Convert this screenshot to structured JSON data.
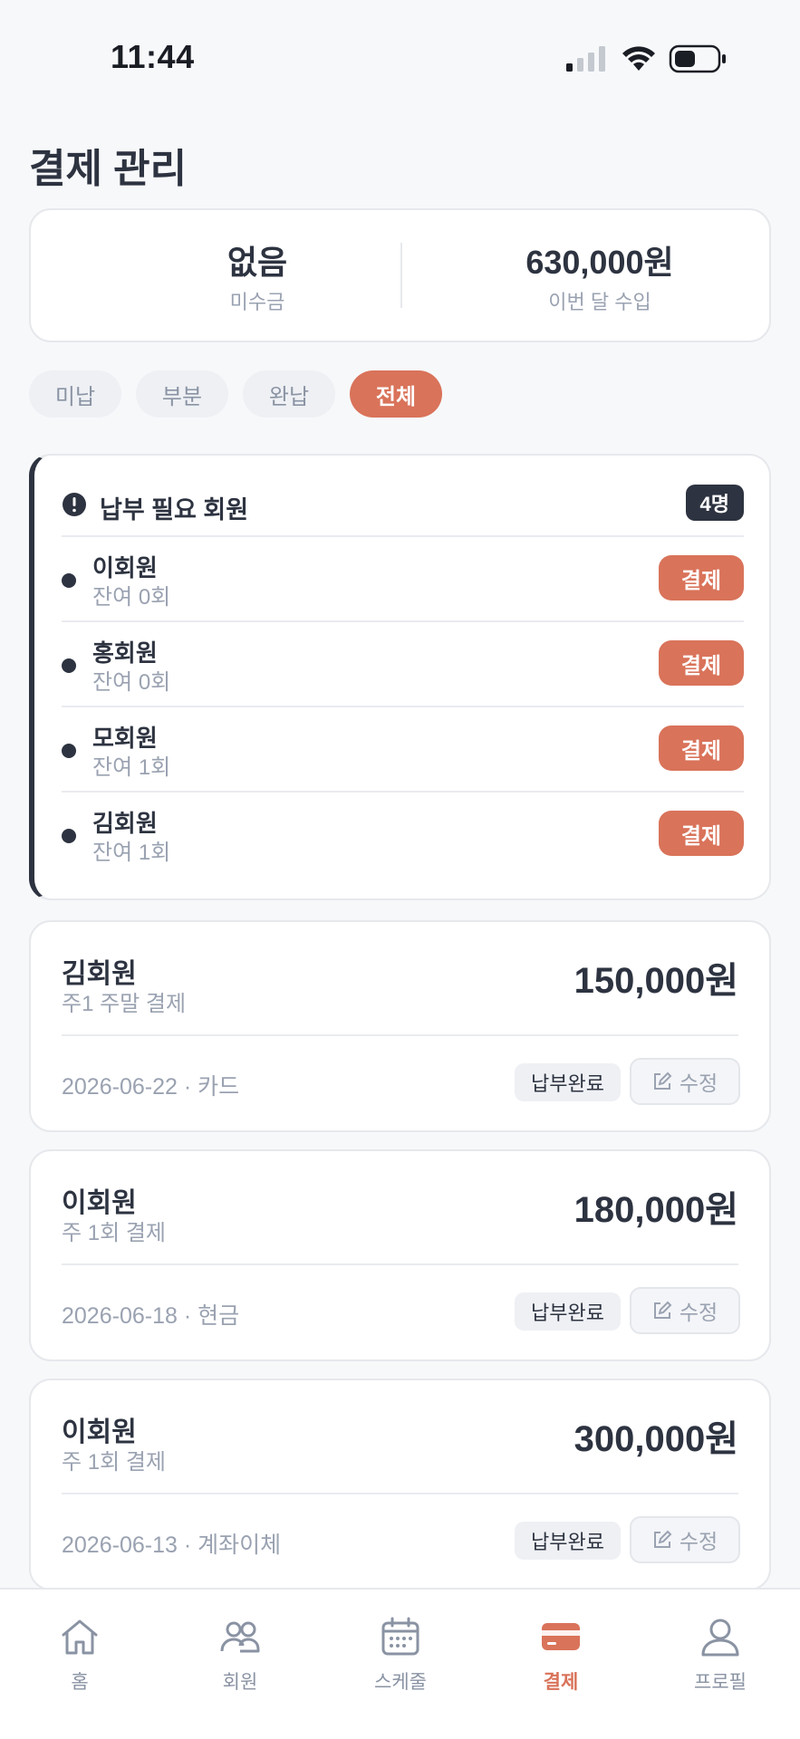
{
  "status_bar": {
    "time": "11:44"
  },
  "page": {
    "title": "결제 관리"
  },
  "summary": {
    "unpaid_value": "없음",
    "unpaid_label": "미수금",
    "income_value": "630,000원",
    "income_label": "이번 달 수입"
  },
  "filters": [
    {
      "label": "미납",
      "active": false
    },
    {
      "label": "부분",
      "active": false
    },
    {
      "label": "완납",
      "active": false
    },
    {
      "label": "전체",
      "active": true
    }
  ],
  "due_section": {
    "title": "납부 필요 회원",
    "count": "4명",
    "members": [
      {
        "name": "이회원",
        "remaining": "잔여 0회",
        "button": "결제"
      },
      {
        "name": "홍회원",
        "remaining": "잔여 0회",
        "button": "결제"
      },
      {
        "name": "모회원",
        "remaining": "잔여 1회",
        "button": "결제"
      },
      {
        "name": "김회원",
        "remaining": "잔여 1회",
        "button": "결제"
      }
    ]
  },
  "payments": [
    {
      "name": "김회원",
      "plan": "주1 주말 결제",
      "amount": "150,000원",
      "meta": "2026-06-22 · 카드",
      "status": "납부완료",
      "edit_label": "수정"
    },
    {
      "name": "이회원",
      "plan": "주 1회 결제",
      "amount": "180,000원",
      "meta": "2026-06-18 · 현금",
      "status": "납부완료",
      "edit_label": "수정"
    },
    {
      "name": "이회원",
      "plan": "주 1회 결제",
      "amount": "300,000원",
      "meta": "2026-06-13 · 계좌이체",
      "status": "납부완료",
      "edit_label": "수정"
    }
  ],
  "tab_bar": [
    {
      "label": "홈",
      "icon": "home-icon",
      "active": false
    },
    {
      "label": "회원",
      "icon": "members-icon",
      "active": false
    },
    {
      "label": "스케줄",
      "icon": "calendar-icon",
      "active": false
    },
    {
      "label": "결제",
      "icon": "card-icon",
      "active": true
    },
    {
      "label": "프로필",
      "icon": "profile-icon",
      "active": false
    }
  ],
  "colors": {
    "accent": "#d9735a",
    "dark": "#2d3340",
    "muted": "#9aa2b1"
  }
}
